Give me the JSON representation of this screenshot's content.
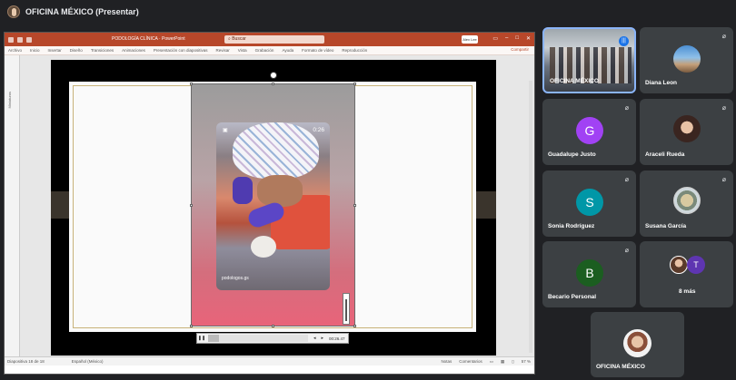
{
  "meeting": {
    "title": "OFICINA MÉXICO (Presentar)"
  },
  "presentation": {
    "app_title": "PODOLOGÍA CLÍNICA · PowerPoint",
    "search_placeholder": "Buscar",
    "user_label": "Alex Lee",
    "menu_items": [
      "Archivo",
      "Inicio",
      "Insertar",
      "Diseño",
      "Transiciones",
      "Animaciones",
      "Presentación con diapositivas",
      "Revisar",
      "Vista",
      "Grabación",
      "Ayuda",
      "Formato de vídeo",
      "Reproducción"
    ],
    "share_label": "Compartir",
    "thumbnail_label": "Miniaturas",
    "video": {
      "time": "0:26",
      "watermark": "podologos.gs",
      "current_time": "00:26.47"
    },
    "status": {
      "slide": "Diapositiva 18 de 18",
      "language": "Español (México)",
      "notes": "Notas",
      "comments": "Comentarios",
      "zoom": "57 %"
    }
  },
  "participants": [
    {
      "name": "OFICINA MÉXICO",
      "type": "video",
      "speaking": true
    },
    {
      "name": "Diana Leon",
      "type": "photo",
      "muted": true
    },
    {
      "name": "Guadalupe Justo",
      "type": "initial",
      "initial": "G",
      "color": "#a142f4",
      "muted": true
    },
    {
      "name": "Araceli Rueda",
      "type": "photo",
      "muted": true
    },
    {
      "name": "Sonia Rodríguez",
      "type": "initial",
      "initial": "S",
      "color": "#0097a7",
      "muted": true
    },
    {
      "name": "Susana García",
      "type": "photo",
      "muted": true
    },
    {
      "name": "Becario Personal",
      "type": "initial",
      "initial": "B",
      "color": "#1b5e20",
      "muted": true
    },
    {
      "name": "8 más",
      "type": "more",
      "initial": "T",
      "color": "#5e35b1"
    },
    {
      "name": "OFICINA MÉXICO",
      "type": "self"
    }
  ]
}
